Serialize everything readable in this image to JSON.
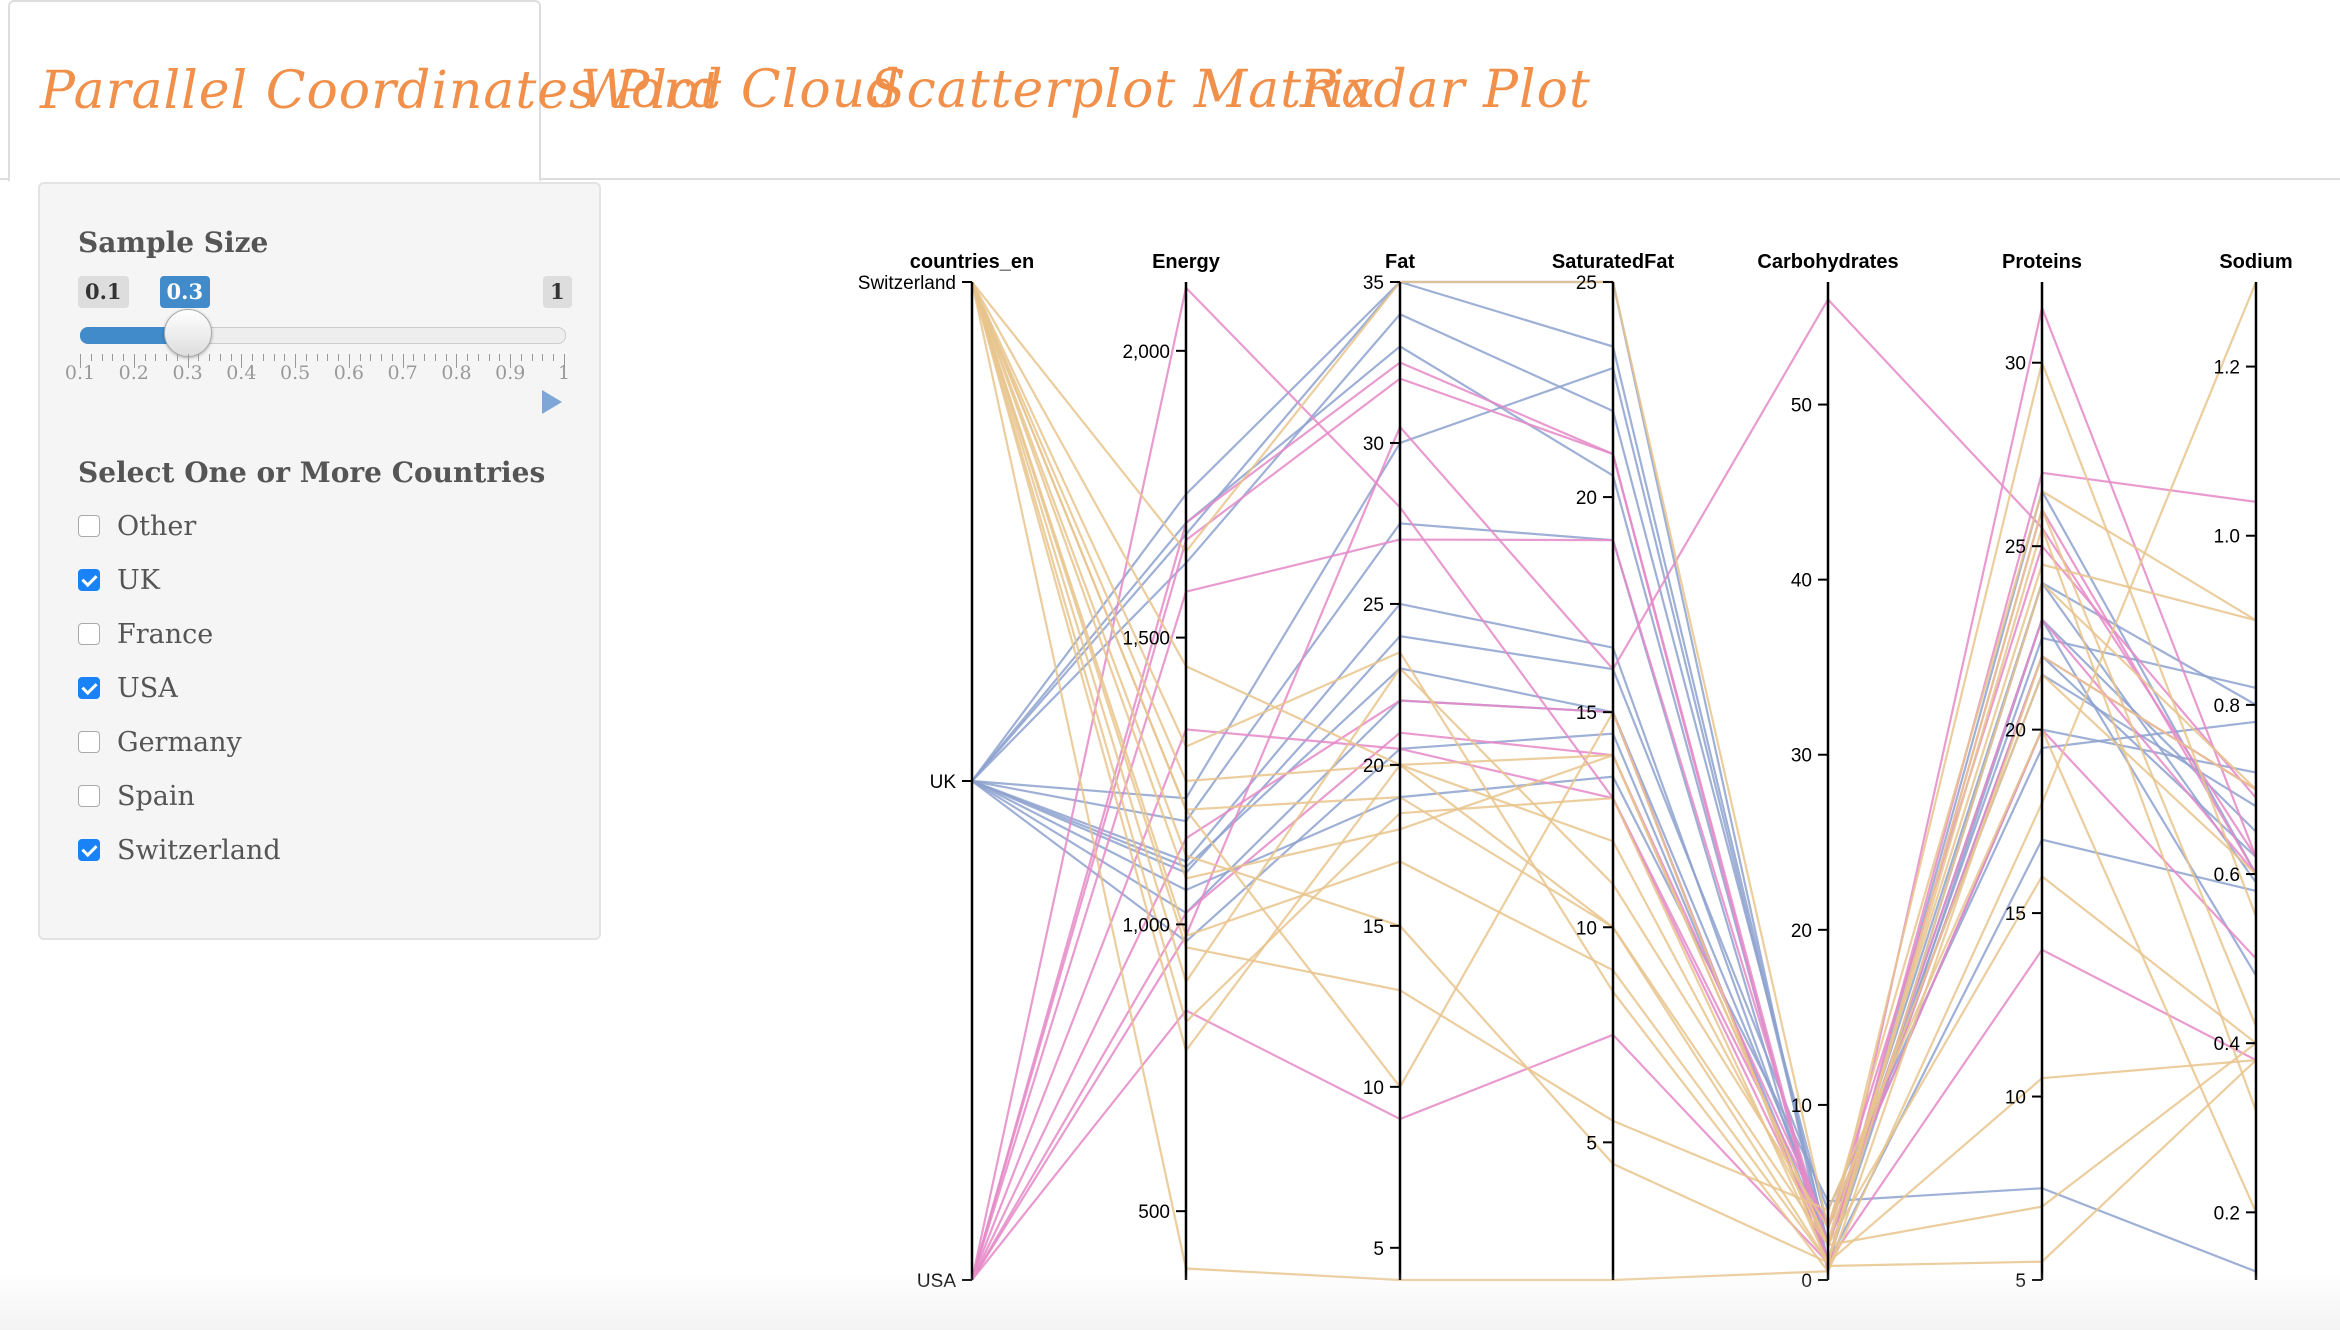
{
  "tabs": [
    {
      "label": "Parallel Coordinates Plot",
      "active": true
    },
    {
      "label": "Word Cloud",
      "active": false
    },
    {
      "label": "Scatterplot Matrix",
      "active": false
    },
    {
      "label": "Radar Plot",
      "active": false
    }
  ],
  "sidebar": {
    "sample_size": {
      "title": "Sample Size",
      "min_label": "0.1",
      "max_label": "1",
      "value": 0.3,
      "value_label": "0.3",
      "tick_labels": [
        "0.1",
        "0.2",
        "0.3",
        "0.4",
        "0.5",
        "0.6",
        "0.7",
        "0.8",
        "0.9",
        "1"
      ]
    },
    "countries": {
      "title": "Select One or More Countries",
      "options": [
        {
          "label": "Other",
          "checked": false
        },
        {
          "label": "UK",
          "checked": true
        },
        {
          "label": "France",
          "checked": false
        },
        {
          "label": "USA",
          "checked": true
        },
        {
          "label": "Germany",
          "checked": false
        },
        {
          "label": "Spain",
          "checked": false
        },
        {
          "label": "Switzerland",
          "checked": true
        }
      ]
    }
  },
  "colors": {
    "tab_text": "#f0904a",
    "uk": "#8ea2cf",
    "usa": "#e58ac8",
    "switzerland": "#e8c48d"
  },
  "chart_data": {
    "type": "parallel-coordinates",
    "axes": [
      {
        "name": "countries_en",
        "categorical": true,
        "categories": [
          "Switzerland",
          "UK",
          "USA"
        ]
      },
      {
        "name": "Energy",
        "range": [
          380,
          2120
        ],
        "ticks": [
          "500",
          "1,000",
          "1,500",
          "2,000"
        ],
        "tick_values": [
          500,
          1000,
          1500,
          2000
        ]
      },
      {
        "name": "Fat",
        "range": [
          4,
          35
        ],
        "ticks": [
          "5",
          "10",
          "15",
          "20",
          "25",
          "30",
          "35"
        ],
        "tick_values": [
          5,
          10,
          15,
          20,
          25,
          30,
          35
        ]
      },
      {
        "name": "SaturatedFat",
        "range": [
          1.8,
          25
        ],
        "ticks": [
          "5",
          "10",
          "15",
          "20",
          "25"
        ],
        "tick_values": [
          5,
          10,
          15,
          20,
          25
        ]
      },
      {
        "name": "Carbohydrates",
        "range": [
          0,
          57
        ],
        "ticks": [
          "0",
          "10",
          "20",
          "30",
          "40",
          "50"
        ],
        "tick_values": [
          0,
          10,
          20,
          30,
          40,
          50
        ]
      },
      {
        "name": "Proteins",
        "range": [
          5,
          32.2
        ],
        "ticks": [
          "5",
          "10",
          "15",
          "20",
          "25",
          "30"
        ],
        "tick_values": [
          5,
          10,
          15,
          20,
          25,
          30
        ]
      },
      {
        "name": "Sodium",
        "range": [
          0.12,
          1.3
        ],
        "ticks": [
          "0.2",
          "0.4",
          "0.6",
          "0.8",
          "1.0",
          "1.2"
        ],
        "tick_values": [
          0.2,
          0.4,
          0.6,
          0.8,
          1.0,
          1.2
        ]
      }
    ],
    "series": [
      {
        "name": "UK",
        "rows": [
          [
            1750,
            35,
            23.5,
            2,
            22,
            0.62
          ],
          [
            1680,
            35,
            25,
            1,
            24,
            0.8
          ],
          [
            1630,
            34,
            22,
            3,
            20,
            0.72
          ],
          [
            1700,
            33,
            20.5,
            1,
            26.5,
            0.6
          ],
          [
            1220,
            30,
            23,
            2,
            22.5,
            0.82
          ],
          [
            1180,
            27.5,
            19,
            1,
            23,
            0.65
          ],
          [
            1110,
            25,
            16.5,
            2,
            24,
            0.59
          ],
          [
            1090,
            24,
            16,
            4,
            19.5,
            0.78
          ],
          [
            1020,
            22,
            15,
            3,
            21.5,
            0.68
          ],
          [
            970,
            20.5,
            14.5,
            2,
            23,
            0.48
          ],
          [
            1060,
            19,
            13.5,
            4.5,
            7.5,
            0.13
          ],
          [
            1100,
            23,
            15,
            1,
            17,
            0.58
          ]
        ]
      },
      {
        "name": "USA",
        "rows": [
          [
            2110,
            28,
            13,
            2,
            23,
            0.6
          ],
          [
            1700,
            32.5,
            21,
            0.5,
            31.5,
            0.62
          ],
          [
            1670,
            32,
            21,
            1,
            26,
            0.6
          ],
          [
            1580,
            27,
            19,
            2,
            22,
            0.7
          ],
          [
            1150,
            22,
            15,
            1,
            27,
            1.04
          ],
          [
            1020,
            21,
            14,
            3,
            25,
            0.69
          ],
          [
            980,
            30.5,
            16,
            56,
            25.5,
            0.62
          ],
          [
            850,
            9,
            7.5,
            1,
            14,
            0.38
          ],
          [
            1340,
            20.5,
            13,
            3,
            20,
            0.5
          ]
        ]
      },
      {
        "name": "Switzerland",
        "rows": [
          [
            400,
            4,
            1.8,
            0.5,
            18,
            1.3
          ],
          [
            900,
            23,
            11,
            3,
            21.5,
            0.6
          ],
          [
            1200,
            19,
            10,
            1,
            24,
            0.7
          ],
          [
            1250,
            20,
            12,
            2,
            30,
            0.55
          ],
          [
            980,
            17,
            9,
            1,
            26,
            0.42
          ],
          [
            780,
            20,
            10,
            2,
            16,
            0.4
          ],
          [
            1310,
            23.5,
            8.5,
            0.5,
            22,
            0.7
          ],
          [
            1650,
            35,
            25,
            3,
            26.5,
            0.9
          ],
          [
            1120,
            15,
            4.5,
            1,
            10.5,
            0.38
          ],
          [
            1080,
            18,
            14,
            2,
            7,
            0.4
          ],
          [
            1200,
            10,
            15,
            0.8,
            5.5,
            0.38
          ],
          [
            960,
            13,
            5.5,
            4,
            20,
            0.2
          ],
          [
            830,
            18.5,
            13,
            1,
            25.5,
            0.32
          ],
          [
            1450,
            20,
            14,
            2,
            24.5,
            0.9
          ]
        ]
      }
    ]
  }
}
